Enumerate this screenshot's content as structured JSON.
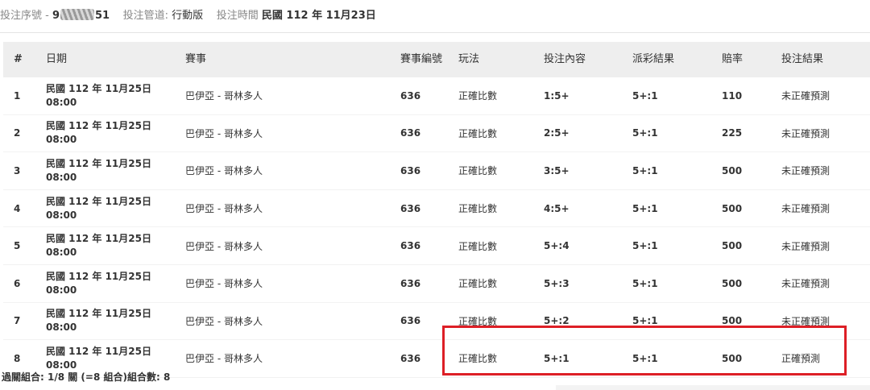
{
  "header": {
    "serial_label": "投注序號 -",
    "serial_prefix": "9",
    "serial_suffix": "51",
    "channel_label": "投注管道:",
    "channel_value": "行動版",
    "time_label": "投注時間",
    "time_value": "民國 112 年 11月23日"
  },
  "table": {
    "columns": [
      "#",
      "日期",
      "賽事",
      "賽事編號",
      "玩法",
      "投注內容",
      "派彩結果",
      "賠率",
      "投注結果"
    ],
    "rows": [
      {
        "idx": "1",
        "date": "民國 112 年 11月25日",
        "time": "08:00",
        "match": "巴伊亞 - 哥林多人",
        "match_no": "636",
        "play": "正確比數",
        "bet": "1:5+",
        "result": "5+:1",
        "odds": "110",
        "outcome": "未正確預測"
      },
      {
        "idx": "2",
        "date": "民國 112 年 11月25日",
        "time": "08:00",
        "match": "巴伊亞 - 哥林多人",
        "match_no": "636",
        "play": "正確比數",
        "bet": "2:5+",
        "result": "5+:1",
        "odds": "225",
        "outcome": "未正確預測"
      },
      {
        "idx": "3",
        "date": "民國 112 年 11月25日",
        "time": "08:00",
        "match": "巴伊亞 - 哥林多人",
        "match_no": "636",
        "play": "正確比數",
        "bet": "3:5+",
        "result": "5+:1",
        "odds": "500",
        "outcome": "未正確預測"
      },
      {
        "idx": "4",
        "date": "民國 112 年 11月25日",
        "time": "08:00",
        "match": "巴伊亞 - 哥林多人",
        "match_no": "636",
        "play": "正確比數",
        "bet": "4:5+",
        "result": "5+:1",
        "odds": "500",
        "outcome": "未正確預測"
      },
      {
        "idx": "5",
        "date": "民國 112 年 11月25日",
        "time": "08:00",
        "match": "巴伊亞 - 哥林多人",
        "match_no": "636",
        "play": "正確比數",
        "bet": "5+:4",
        "result": "5+:1",
        "odds": "500",
        "outcome": "未正確預測"
      },
      {
        "idx": "6",
        "date": "民國 112 年 11月25日",
        "time": "08:00",
        "match": "巴伊亞 - 哥林多人",
        "match_no": "636",
        "play": "正確比數",
        "bet": "5+:3",
        "result": "5+:1",
        "odds": "500",
        "outcome": "未正確預測"
      },
      {
        "idx": "7",
        "date": "民國 112 年 11月25日",
        "time": "08:00",
        "match": "巴伊亞 - 哥林多人",
        "match_no": "636",
        "play": "正確比數",
        "bet": "5+:2",
        "result": "5+:1",
        "odds": "500",
        "outcome": "未正確預測"
      },
      {
        "idx": "8",
        "date": "民國 112 年 11月25日",
        "time": "08:00",
        "match": "巴伊亞 - 哥林多人",
        "match_no": "636",
        "play": "正確比數",
        "bet": "5+:1",
        "result": "5+:1",
        "odds": "500",
        "outcome": "正確預測"
      }
    ]
  },
  "footer": {
    "combo_label": "過關組合: 1/8 關 (=8 組合)組合數: 8"
  },
  "highlight_color": "#dd1f26"
}
